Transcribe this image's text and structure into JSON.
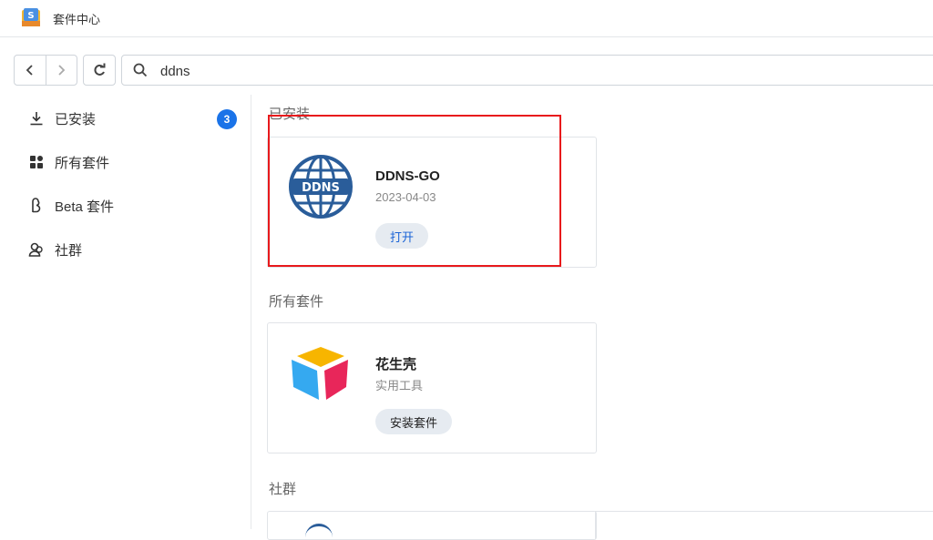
{
  "window": {
    "title": "套件中心",
    "app_icon": "package-center-icon"
  },
  "toolbar": {
    "back_icon": "chevron-left-icon",
    "forward_icon": "chevron-right-icon",
    "refresh_icon": "refresh-icon",
    "search_value": "ddns"
  },
  "sidebar": {
    "items": [
      {
        "label": "已安装",
        "icon": "download-icon",
        "badge": "3"
      },
      {
        "label": "所有套件",
        "icon": "grid-icon"
      },
      {
        "label": "Beta 套件",
        "icon": "beta-icon"
      },
      {
        "label": "社群",
        "icon": "community-icon"
      }
    ]
  },
  "sections": {
    "installed": {
      "label": "已安装",
      "card": {
        "name": "DDNS-GO",
        "sub": "2023-04-03",
        "button": "打开",
        "icon": "ddns-globe-icon",
        "icon_text": "DDNS"
      }
    },
    "all": {
      "label": "所有套件",
      "card": {
        "name": "花生壳",
        "sub": "实用工具",
        "button": "安装套件",
        "icon": "cube-icon"
      }
    },
    "community": {
      "label": "社群"
    }
  },
  "colors": {
    "accent": "#1a73e8",
    "highlight": "#e8191c",
    "globe": "#2a5d9a"
  }
}
